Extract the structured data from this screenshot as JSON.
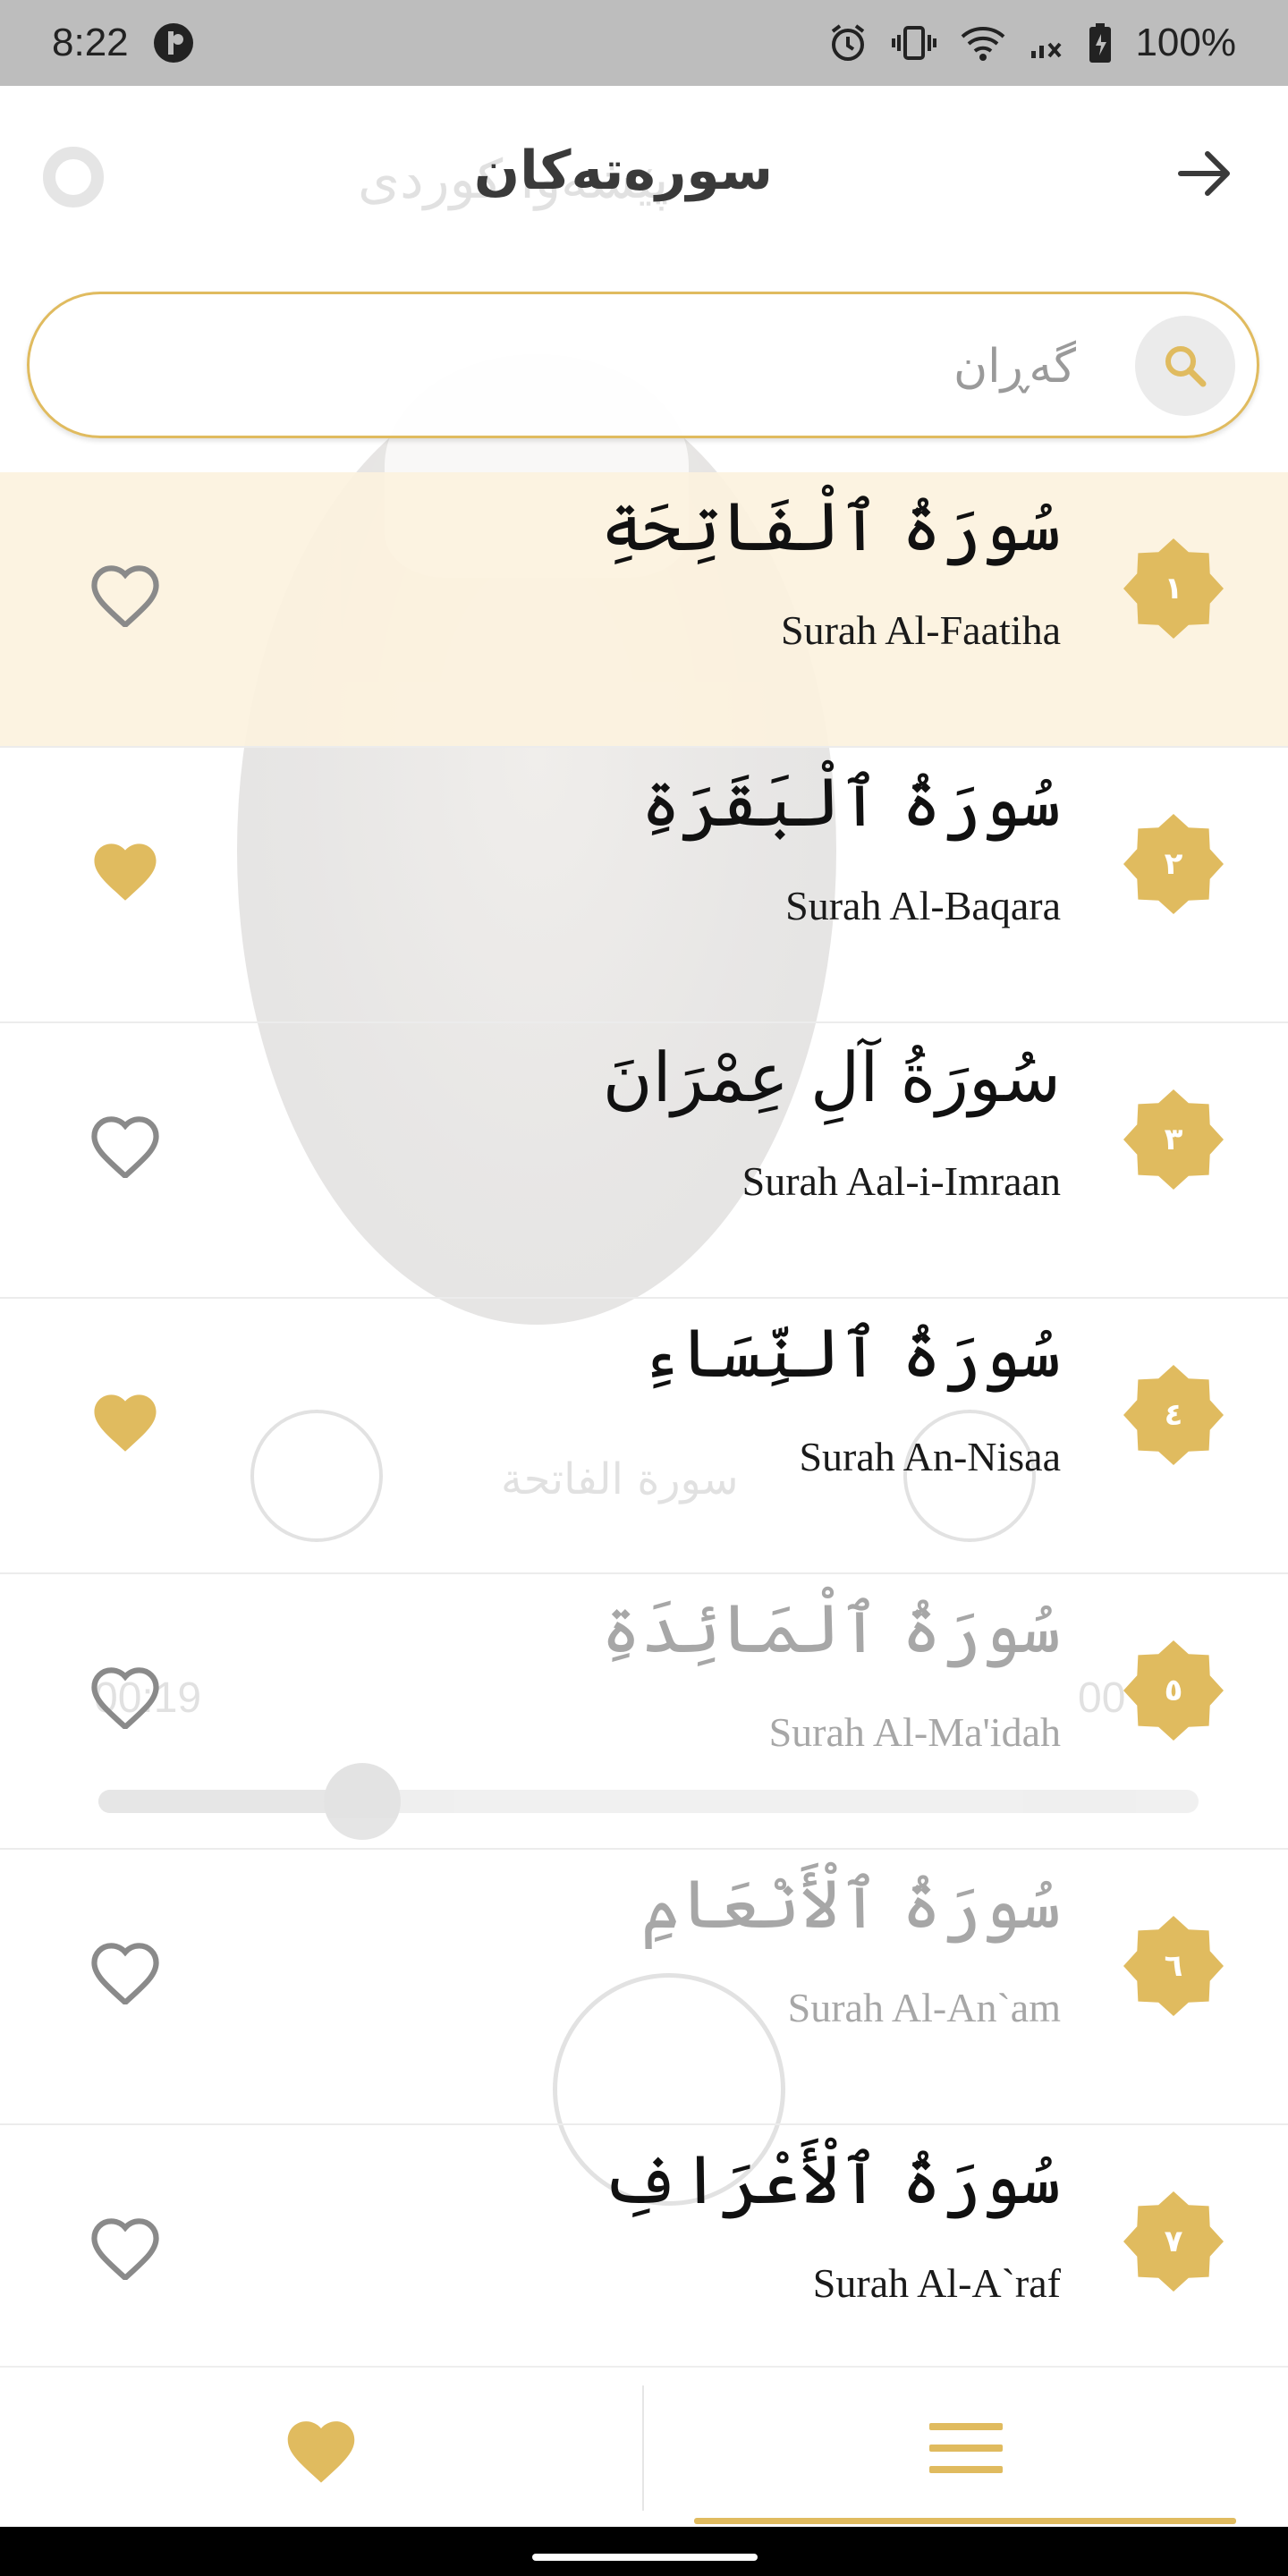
{
  "status_bar": {
    "time": "8:22",
    "battery": "100%"
  },
  "background_player": {
    "title": "پێشەوا کوردی",
    "current_surah": "سورة الفاتحة",
    "elapsed": "00:19",
    "duration": "00",
    "progress": 0.24
  },
  "header": {
    "title": "سورەتەکان"
  },
  "search": {
    "placeholder": "گەڕان",
    "value": ""
  },
  "colors": {
    "accent": "#e0bb5f",
    "selected_row": "#fcf2de",
    "heart_outline": "#8a8a8a"
  },
  "surahs": [
    {
      "number": "١",
      "arabic": "سُورَةُ ٱلْفَاتِحَةِ",
      "english": "Surah Al-Faatiha",
      "favorite": false,
      "selected": true,
      "faded": false
    },
    {
      "number": "٢",
      "arabic": "سُورَةُ ٱلْبَقَرَةِ",
      "english": "Surah Al-Baqara",
      "favorite": true,
      "selected": false,
      "faded": false
    },
    {
      "number": "٣",
      "arabic": "سُورَةُ آلِ عِمْرَانَ",
      "english": "Surah Aal-i-Imraan",
      "favorite": false,
      "selected": false,
      "faded": false
    },
    {
      "number": "٤",
      "arabic": "سُورَةُ ٱلنِّسَاءِ",
      "english": "Surah An-Nisaa",
      "favorite": true,
      "selected": false,
      "faded": false
    },
    {
      "number": "٥",
      "arabic": "سُورَةُ ٱلْمَائِدَةِ",
      "english": "Surah Al-Ma'idah",
      "favorite": false,
      "selected": false,
      "faded": true
    },
    {
      "number": "٦",
      "arabic": "سُورَةُ ٱلْأَنْعَامِ",
      "english": "Surah Al-An`am",
      "favorite": false,
      "selected": false,
      "faded": true
    },
    {
      "number": "٧",
      "arabic": "سُورَةُ ٱلْأَعْرَافِ",
      "english": "Surah Al-A`raf",
      "favorite": false,
      "selected": false,
      "faded": false
    }
  ],
  "bottom_nav": {
    "items": [
      {
        "icon": "heart-icon"
      },
      {
        "icon": "menu-icon",
        "active": true
      }
    ]
  }
}
